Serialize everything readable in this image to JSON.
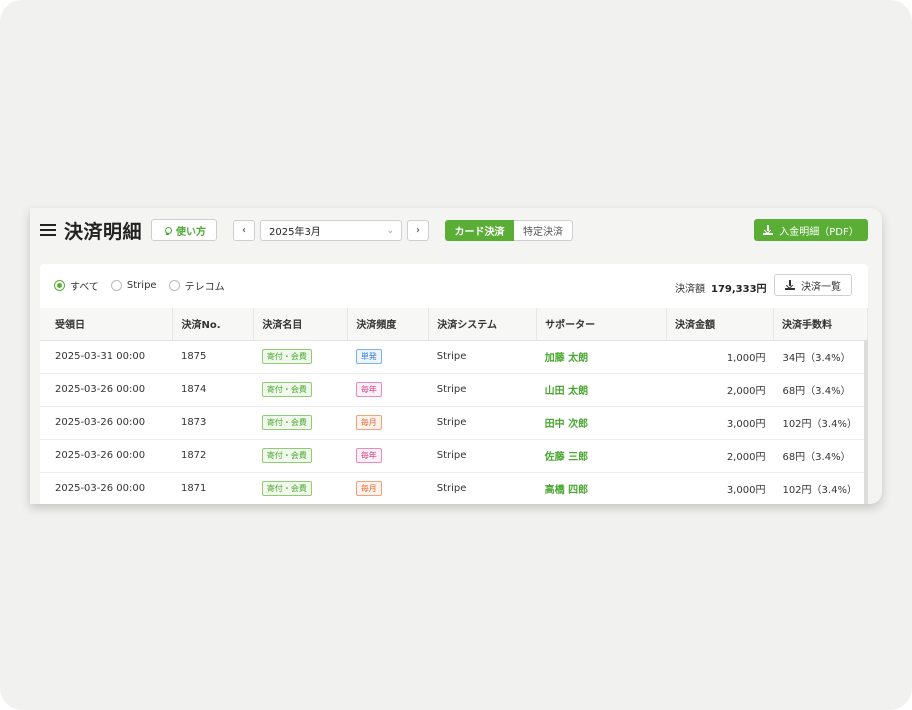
{
  "header": {
    "title": "決済明細",
    "howto_label": "使い方",
    "prev_label": "‹",
    "next_label": "›",
    "month_value": "2025年3月",
    "tabs": [
      {
        "label": "カード決済",
        "active": true
      },
      {
        "label": "特定決済",
        "active": false
      }
    ],
    "pdf_label": "入金明細（PDF）"
  },
  "filters": {
    "options": [
      {
        "label": "すべて",
        "selected": true
      },
      {
        "label": "Stripe",
        "selected": false
      },
      {
        "label": "テレコム",
        "selected": false
      }
    ],
    "total_label": "決済額",
    "total_value": "179,333円",
    "list_label": "決済一覧"
  },
  "table": {
    "columns": [
      "受領日",
      "決済No.",
      "決済名目",
      "決済頻度",
      "決済システム",
      "サポーター",
      "決済金額",
      "決済手数料"
    ],
    "rows": [
      {
        "date": "2025-03-31 00:00",
        "no": "1875",
        "item": "寄付・会費",
        "freq": "単発",
        "freq_color": "b",
        "system": "Stripe",
        "supporter": "加藤 太朗",
        "amount": "1,000円",
        "fee": "34円（3.4%）"
      },
      {
        "date": "2025-03-26 00:00",
        "no": "1874",
        "item": "寄付・会費",
        "freq": "毎年",
        "freq_color": "p",
        "system": "Stripe",
        "supporter": "山田 太朗",
        "amount": "2,000円",
        "fee": "68円（3.4%）"
      },
      {
        "date": "2025-03-26 00:00",
        "no": "1873",
        "item": "寄付・会費",
        "freq": "毎月",
        "freq_color": "o",
        "system": "Stripe",
        "supporter": "田中 次郎",
        "amount": "3,000円",
        "fee": "102円（3.4%）"
      },
      {
        "date": "2025-03-26 00:00",
        "no": "1872",
        "item": "寄付・会費",
        "freq": "毎年",
        "freq_color": "p",
        "system": "Stripe",
        "supporter": "佐藤 三郎",
        "amount": "2,000円",
        "fee": "68円（3.4%）"
      },
      {
        "date": "2025-03-26 00:00",
        "no": "1871",
        "item": "寄付・会費",
        "freq": "毎月",
        "freq_color": "o",
        "system": "Stripe",
        "supporter": "高橋 四郎",
        "amount": "3,000円",
        "fee": "102円（3.4%）"
      }
    ]
  },
  "colors": {
    "accent": "#5aae36",
    "single": "#3a7fd0",
    "yearly": "#d13f8a",
    "monthly": "#e06b34"
  }
}
